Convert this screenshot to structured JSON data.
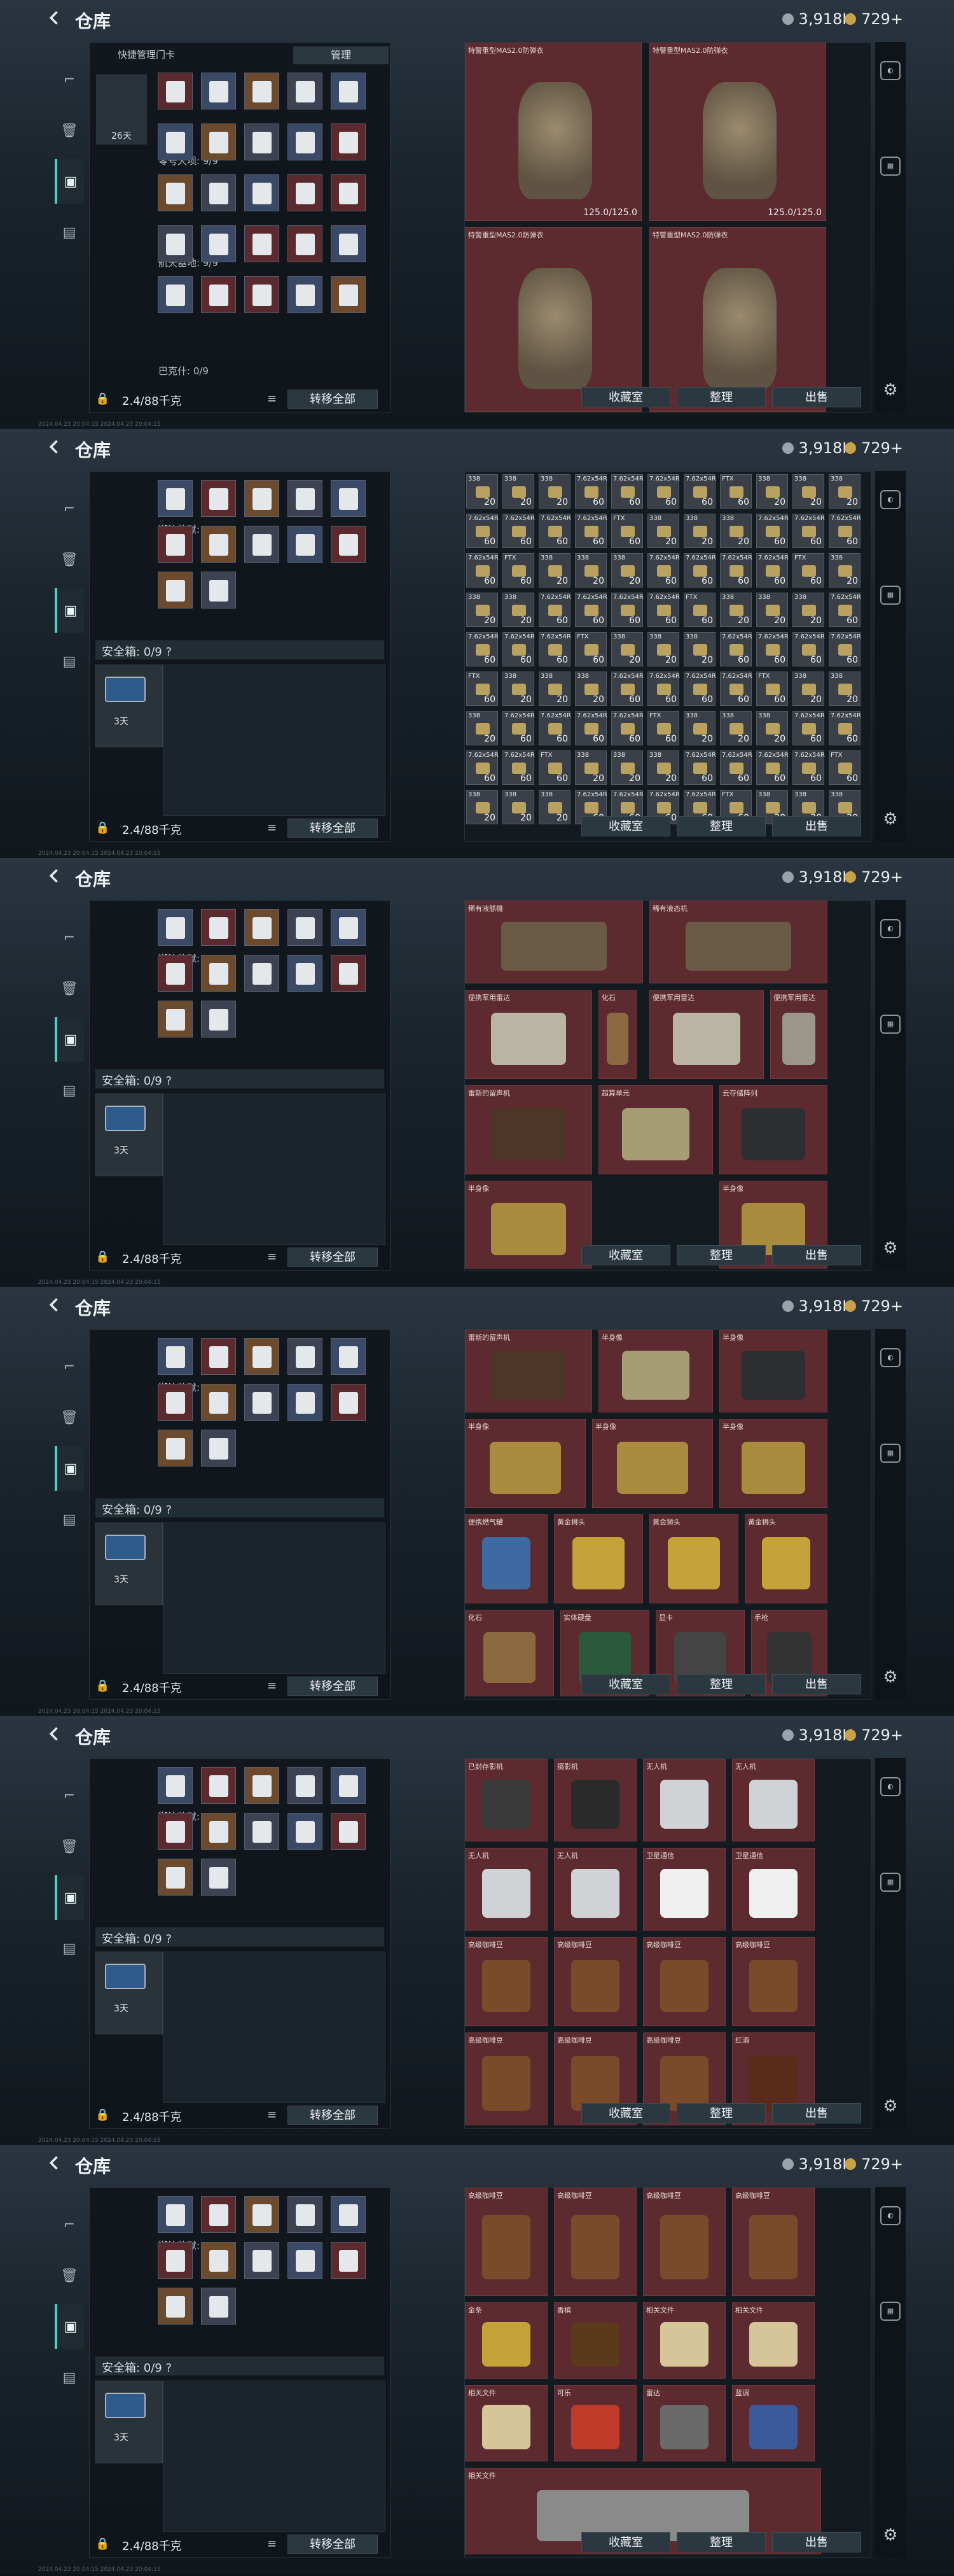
{
  "app": {
    "title": "仓库",
    "currency": "3,918K",
    "premium": "729+"
  },
  "left": {
    "card_title": "快捷管理门卡",
    "manage": "管理",
    "days": "26天",
    "section_zero": "零号大坝: 9/9",
    "section_space": "航天基地: 9/9",
    "section_baisha": "潮汐监狱: 7/9",
    "section_hidden": "巴克什: 0/9",
    "safe_label": "安全箱: 0/9",
    "safe_days": "3天",
    "weight": "2.4/88千克",
    "transfer": "转移全部"
  },
  "right": {
    "btn_collect": "收藏室",
    "btn_sort": "整理",
    "btn_sell": "出售",
    "armor_name": "特警重型MAS2.0防弹衣",
    "armor_dur": "125.0/125.0",
    "ammo_counts": [
      "338",
      "338",
      "338",
      "7.62x54R",
      "7.62x54R",
      "7.62x54R",
      "7.62x54R",
      "FTX",
      "20",
      "20",
      "20",
      "60",
      "60",
      "60",
      "60",
      "60"
    ],
    "s3": {
      "a": "稀有液態機",
      "b": "稀有液态机",
      "c": "便携军用雷达",
      "d": "化石",
      "e": "超算单元",
      "f": "云存储阵列",
      "g": "雷斯的留声机",
      "h": "半身像"
    },
    "s4": {
      "a": "雷斯的留声机",
      "b": "半身像",
      "c": "黄金狮头",
      "d": "便携燃气罐",
      "e": "化石",
      "f": "实体硬盘",
      "g": "显卡",
      "h": "手枪"
    },
    "s5": {
      "a": "已封存影机",
      "b": "摄影机",
      "c": "无人机",
      "d": "卫星通信",
      "e": "高级咖啡豆",
      "f": "红酒"
    },
    "s6": {
      "a": "高级咖啡豆",
      "b": "金条",
      "c": "香槟",
      "d": "相关文件",
      "e": "可乐",
      "f": "雷达",
      "g": "蓝调"
    }
  },
  "timestamp": "2024.04.23 20:04:15 2024.04.23 20:04:15"
}
